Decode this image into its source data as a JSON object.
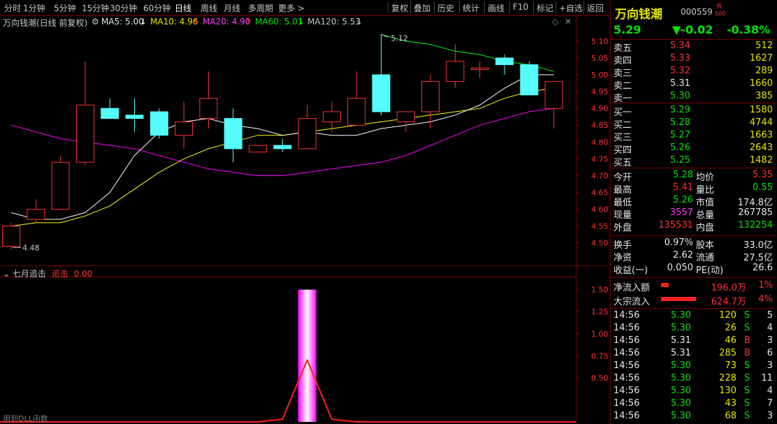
{
  "toolbar": {
    "periods": [
      "分时",
      "1分钟",
      "5分钟",
      "15分钟",
      "30分钟",
      "60分钟",
      "日线",
      "周线",
      "月线",
      "多周期",
      "更多 >"
    ],
    "selected_period": "日线",
    "actions": [
      "复权",
      "叠加",
      "历史",
      "统计",
      "画线",
      "F10",
      "标记",
      "+自选",
      "返回"
    ]
  },
  "chart_header": {
    "title": "万向钱潮(日线 前复权)",
    "ma5": "MA5: 5.00",
    "ma10": "MA10: 4.96",
    "ma20": "MA20: 4.90",
    "ma60": "MA60: 5.01",
    "ma120": "MA120: 5.53",
    "ma5_arrow": "↓",
    "ma10_arrow": "↑",
    "ma20_arrow": "↑",
    "ma60_arrow": "↓",
    "ma120_arrow": "↓"
  },
  "colors": {
    "up": "#ff3232",
    "down": "#54fcfc",
    "ma5": "#ffffff",
    "ma10": "#ffff00",
    "ma20": "#ff00ff",
    "ma60": "#00ff00",
    "grid": "#7a0000"
  },
  "chart_data": [
    {
      "type": "candlestick",
      "title": "万向钱潮(日线 前复权)",
      "ylim": [
        4.46,
        5.16
      ],
      "y_ticks": [
        4.5,
        4.55,
        4.6,
        4.65,
        4.7,
        4.75,
        4.8,
        4.85,
        4.9,
        4.95,
        5.0,
        5.05,
        5.1
      ],
      "annotations": {
        "high_label": "5.12",
        "low_label": "4.48"
      },
      "candles": [
        {
          "o": 4.49,
          "h": 4.56,
          "l": 4.48,
          "c": 4.55
        },
        {
          "o": 4.57,
          "h": 4.63,
          "l": 4.56,
          "c": 4.6
        },
        {
          "o": 4.6,
          "h": 4.76,
          "l": 4.6,
          "c": 4.74
        },
        {
          "o": 4.74,
          "h": 5.04,
          "l": 4.73,
          "c": 4.91
        },
        {
          "o": 4.9,
          "h": 4.93,
          "l": 4.87,
          "c": 4.87
        },
        {
          "o": 4.88,
          "h": 4.93,
          "l": 4.83,
          "c": 4.87
        },
        {
          "o": 4.89,
          "h": 4.9,
          "l": 4.81,
          "c": 4.82
        },
        {
          "o": 4.82,
          "h": 4.92,
          "l": 4.78,
          "c": 4.86
        },
        {
          "o": 4.87,
          "h": 5.01,
          "l": 4.84,
          "c": 4.93
        },
        {
          "o": 4.87,
          "h": 4.9,
          "l": 4.74,
          "c": 4.78
        },
        {
          "o": 4.77,
          "h": 4.79,
          "l": 4.77,
          "c": 4.79
        },
        {
          "o": 4.79,
          "h": 4.81,
          "l": 4.77,
          "c": 4.78
        },
        {
          "o": 4.78,
          "h": 4.91,
          "l": 4.78,
          "c": 4.87
        },
        {
          "o": 4.86,
          "h": 4.92,
          "l": 4.83,
          "c": 4.89
        },
        {
          "o": 4.85,
          "h": 5.01,
          "l": 4.85,
          "c": 4.93
        },
        {
          "o": 5.0,
          "h": 5.12,
          "l": 4.88,
          "c": 4.89
        },
        {
          "o": 4.86,
          "h": 4.89,
          "l": 4.83,
          "c": 4.89
        },
        {
          "o": 4.89,
          "h": 5.0,
          "l": 4.84,
          "c": 4.98
        },
        {
          "o": 4.98,
          "h": 5.09,
          "l": 4.96,
          "c": 5.04
        },
        {
          "o": 5.02,
          "h": 5.04,
          "l": 4.99,
          "c": 5.02
        },
        {
          "o": 5.05,
          "h": 5.06,
          "l": 5.0,
          "c": 5.03
        },
        {
          "o": 5.03,
          "h": 5.04,
          "l": 4.94,
          "c": 4.94
        },
        {
          "o": 4.9,
          "h": 4.98,
          "l": 4.84,
          "c": 4.98
        }
      ],
      "ma5": [
        4.59,
        4.57,
        4.57,
        4.59,
        4.65,
        4.76,
        4.83,
        4.86,
        4.87,
        4.85,
        4.84,
        4.82,
        4.83,
        4.82,
        4.82,
        4.84,
        4.85,
        4.86,
        4.88,
        4.91,
        4.96,
        5.0,
        5.0
      ],
      "ma10": [
        4.55,
        4.56,
        4.56,
        4.58,
        4.61,
        4.66,
        4.71,
        4.75,
        4.78,
        4.8,
        4.82,
        4.82,
        4.83,
        4.84,
        4.85,
        4.86,
        4.87,
        4.88,
        4.89,
        4.9,
        4.93,
        4.95,
        4.96
      ],
      "ma20": [
        4.85,
        4.83,
        4.81,
        4.8,
        4.79,
        4.78,
        4.76,
        4.74,
        4.72,
        4.71,
        4.7,
        4.7,
        4.71,
        4.72,
        4.73,
        4.74,
        4.76,
        4.79,
        4.82,
        4.85,
        4.87,
        4.89,
        4.9
      ],
      "ma60": [
        null,
        null,
        null,
        null,
        null,
        null,
        null,
        null,
        null,
        null,
        null,
        null,
        null,
        null,
        null,
        5.12,
        5.1,
        5.09,
        5.07,
        5.06,
        5.04,
        5.03,
        5.01
      ]
    },
    {
      "type": "bar",
      "title": "七月追击",
      "series_label": "追击",
      "value_label": "0.00",
      "ylim": [
        0,
        1.6
      ],
      "y_ticks": [
        0.5,
        0.75,
        1.0,
        1.25,
        1.5
      ],
      "values": [
        0,
        0,
        0,
        0,
        0,
        0,
        0,
        0,
        0,
        0,
        0,
        0,
        1.5,
        0,
        0,
        0,
        0,
        0,
        0,
        0,
        0,
        0,
        0
      ],
      "line": [
        0,
        0,
        0,
        0,
        0,
        0,
        0,
        0,
        0,
        0,
        0,
        0.03,
        0.7,
        0.03,
        0,
        0,
        0,
        0,
        0,
        0,
        0,
        0,
        0
      ]
    }
  ],
  "footer_label": "用到DLL函数",
  "quote": {
    "name": "万向钱潮",
    "code": "000559",
    "badge": "R",
    "badge_sub": "500",
    "price": "5.29",
    "change": "▼-0.02",
    "pct": "-0.38%",
    "asks": [
      {
        "label": "卖五",
        "price": "5.34",
        "vol": "512"
      },
      {
        "label": "卖四",
        "price": "5.33",
        "vol": "1627"
      },
      {
        "label": "卖三",
        "price": "5.32",
        "vol": "289"
      },
      {
        "label": "卖二",
        "price": "5.31",
        "vol": "1660"
      },
      {
        "label": "卖一",
        "price": "5.30",
        "vol": "385"
      }
    ],
    "bids": [
      {
        "label": "买一",
        "price": "5.29",
        "vol": "1580"
      },
      {
        "label": "买二",
        "price": "5.28",
        "vol": "4744"
      },
      {
        "label": "买三",
        "price": "5.27",
        "vol": "1663"
      },
      {
        "label": "买四",
        "price": "5.26",
        "vol": "2643"
      },
      {
        "label": "买五",
        "price": "5.25",
        "vol": "1482"
      }
    ],
    "stats": [
      {
        "l1": "今开",
        "v1": "5.28",
        "l2": "均价",
        "v2": "5.35"
      },
      {
        "l1": "最高",
        "v1": "5.41",
        "l2": "量比",
        "v2": "0.55"
      },
      {
        "l1": "最低",
        "v1": "5.26",
        "l2": "市值",
        "v2": "174.8亿"
      },
      {
        "l1": "现量",
        "v1": "3557",
        "l2": "总量",
        "v2": "267785"
      },
      {
        "l1": "外盘",
        "v1": "135531",
        "l2": "内盘",
        "v2": "132254"
      }
    ],
    "stats2": [
      {
        "l1": "换手",
        "v1": "0.97%",
        "l2": "股本",
        "v2": "33.0亿"
      },
      {
        "l1": "净资",
        "v1": "2.62",
        "l2": "流通",
        "v2": "27.5亿"
      },
      {
        "l1": "收益(一)",
        "v1": "0.050",
        "l2": "PE(动)",
        "v2": "26.6"
      }
    ],
    "flows": [
      {
        "label": "净流入额",
        "value": "196.0万",
        "pct": "1%",
        "bar": 0.2
      },
      {
        "label": "大宗流入",
        "value": "624.7万",
        "pct": "4%",
        "bar": 0.9
      }
    ],
    "ticks": [
      {
        "t": "14:56",
        "p": "5.30",
        "v": "120",
        "s": "S",
        "n": "5"
      },
      {
        "t": "14:56",
        "p": "5.30",
        "v": "26",
        "s": "S",
        "n": "4"
      },
      {
        "t": "14:56",
        "p": "5.31",
        "v": "46",
        "s": "B",
        "n": "3"
      },
      {
        "t": "14:56",
        "p": "5.31",
        "v": "285",
        "s": "B",
        "n": "6"
      },
      {
        "t": "14:56",
        "p": "5.30",
        "v": "73",
        "s": "S",
        "n": "3"
      },
      {
        "t": "14:56",
        "p": "5.30",
        "v": "228",
        "s": "S",
        "n": "11"
      },
      {
        "t": "14:56",
        "p": "5.30",
        "v": "130",
        "s": "S",
        "n": "4"
      },
      {
        "t": "14:56",
        "p": "5.30",
        "v": "43",
        "s": "S",
        "n": "7"
      },
      {
        "t": "14:56",
        "p": "5.30",
        "v": "68",
        "s": "S",
        "n": "3"
      }
    ]
  }
}
